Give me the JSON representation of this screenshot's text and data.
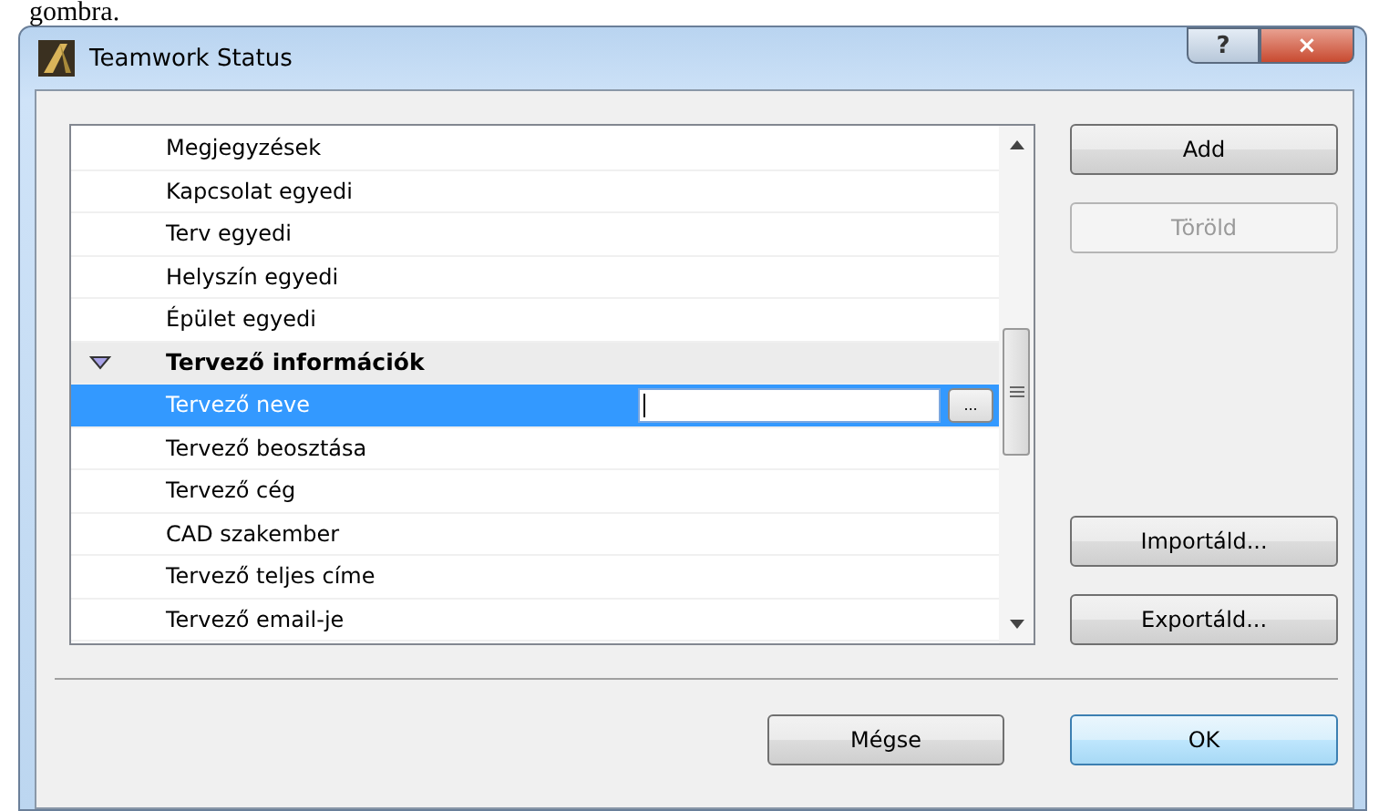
{
  "page_text": "gombra.",
  "window": {
    "title": "Teamwork Status",
    "help": "?",
    "close": "×"
  },
  "list": {
    "rows": [
      {
        "kind": "item",
        "label": "Megjegyzések",
        "selected": false
      },
      {
        "kind": "item",
        "label": "Kapcsolat egyedi",
        "selected": false
      },
      {
        "kind": "item",
        "label": "Terv egyedi",
        "selected": false
      },
      {
        "kind": "item",
        "label": "Helyszín egyedi",
        "selected": false
      },
      {
        "kind": "item",
        "label": "Épület egyedi",
        "selected": false
      },
      {
        "kind": "group",
        "label": "Tervező információk",
        "expanded": true,
        "selected": false
      },
      {
        "kind": "item",
        "label": "Tervező neve",
        "selected": true,
        "browse": "..."
      },
      {
        "kind": "item",
        "label": "Tervező beosztása",
        "selected": false
      },
      {
        "kind": "item",
        "label": "Tervező cég",
        "selected": false
      },
      {
        "kind": "item",
        "label": "CAD szakember",
        "selected": false
      },
      {
        "kind": "item",
        "label": "Tervező teljes címe",
        "selected": false
      },
      {
        "kind": "item",
        "label": "Tervező email-je",
        "selected": false
      }
    ]
  },
  "side_buttons": [
    {
      "label": "Add",
      "disabled": false
    },
    {
      "label": "Töröld",
      "disabled": true
    },
    {
      "label": "Importáld...",
      "disabled": false
    },
    {
      "label": "Exportáld...",
      "disabled": false
    }
  ],
  "footer_buttons": [
    {
      "label": "Mégse",
      "default": false
    },
    {
      "label": "OK",
      "default": true
    }
  ]
}
